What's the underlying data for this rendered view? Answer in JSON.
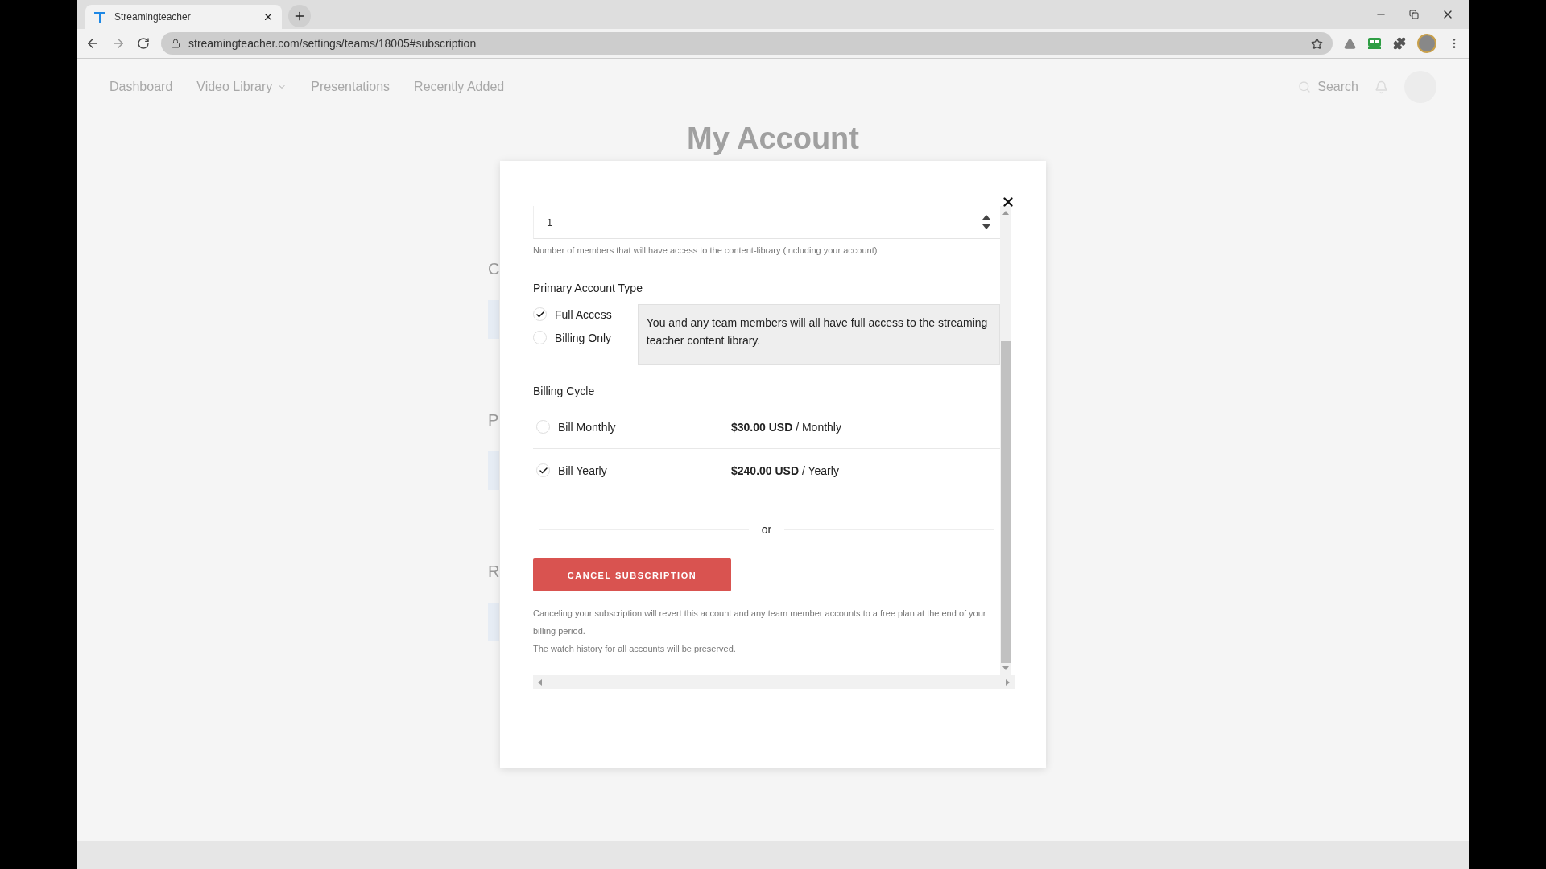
{
  "browser": {
    "tab_title": "Streamingteacher",
    "url": "streamingteacher.com/settings/teams/18005#subscription"
  },
  "nav": {
    "items": [
      {
        "label": "Dashboard",
        "kind": "link"
      },
      {
        "label": "Video Library",
        "kind": "dropdown"
      },
      {
        "label": "Presentations",
        "kind": "link"
      },
      {
        "label": "Recently Added",
        "kind": "link"
      }
    ],
    "search_placeholder": "Search"
  },
  "page_title": "My Account",
  "background_headings": [
    "C",
    "P",
    "R"
  ],
  "modal": {
    "members": {
      "value": "1",
      "help": "Number of members that will have access to the content-library (including your account)"
    },
    "account_type": {
      "heading": "Primary Account Type",
      "options": [
        {
          "label": "Full Access",
          "selected": true
        },
        {
          "label": "Billing Only",
          "selected": false
        }
      ],
      "info": "You and any team members will all have full access to the streaming teacher content library."
    },
    "billing_cycle": {
      "heading": "Billing Cycle",
      "options": [
        {
          "label": "Bill Monthly",
          "price": "**$30.00 USD** / Monthly",
          "selected": false
        },
        {
          "label": "Bill Yearly",
          "price": "**$240.00 USD** / Yearly",
          "selected": true
        }
      ]
    },
    "separator": "or",
    "cancel_button": "CANCEL SUBSCRIPTION",
    "notes": [
      "Canceling your subscription will revert this account and any team member accounts to a free plan at the end of your billing period.",
      "The watch history for all accounts will be preserved."
    ]
  }
}
